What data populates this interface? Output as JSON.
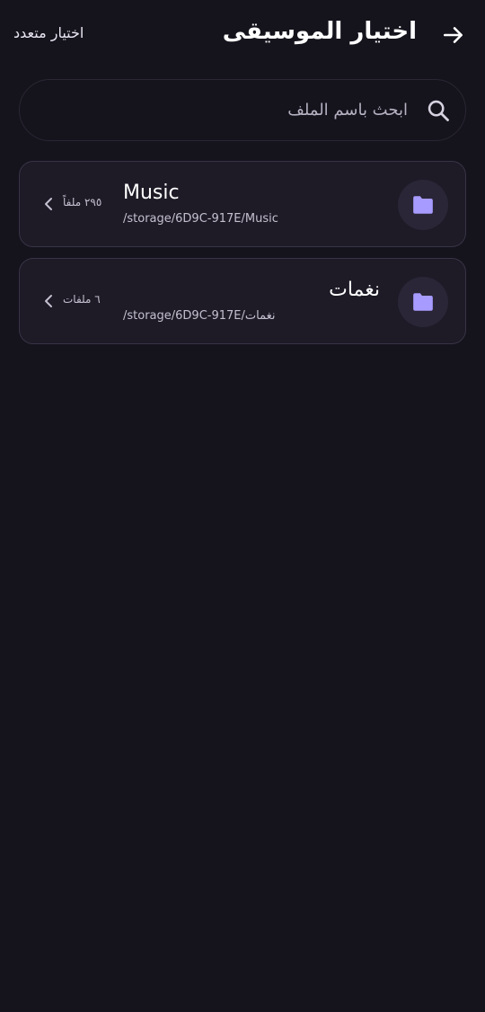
{
  "header": {
    "title": "اختيار الموسيقى",
    "back_icon": "arrow-right-icon",
    "multi_select_label": "اختيار متعدد"
  },
  "search": {
    "placeholder": "ابحث باسم الملف",
    "value": "",
    "icon": "search-icon"
  },
  "folders": [
    {
      "name": "Music",
      "path": "/storage/6D9C-917E/Music",
      "count": "٢٩٥ ملفاً",
      "icon": "folder-icon"
    },
    {
      "name": "نغمات",
      "path": "/storage/6D9C-917E/نغمات",
      "count": "٦ ملفات",
      "icon": "folder-icon"
    }
  ],
  "colors": {
    "background": "#15131c",
    "card": "#1e1b27",
    "accent": "#a79bff"
  }
}
